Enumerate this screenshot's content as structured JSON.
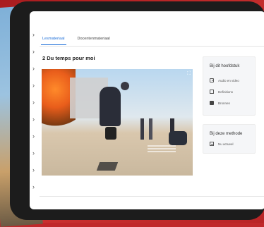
{
  "tabs": [
    {
      "label": "Lesmateriaal",
      "active": true
    },
    {
      "label": "Docentenmateriaal",
      "active": false
    }
  ],
  "lesson": {
    "title": "2 Du temps pour moi"
  },
  "side_panel": {
    "chapter_card": {
      "title": "Bij dit hoofdstuk",
      "items": [
        {
          "label": "Audio en video",
          "icon": "video-icon"
        },
        {
          "label": "Definitions",
          "icon": "document-icon"
        },
        {
          "label": "Bronnen",
          "icon": "book-icon"
        }
      ]
    },
    "method_card": {
      "title": "Bij deze methode",
      "items": [
        {
          "label": "Nu actueel",
          "icon": "news-icon"
        }
      ]
    }
  },
  "colors": {
    "accent": "#1d6ed8",
    "background": "#c0282a",
    "device": "#1c1c1c"
  }
}
